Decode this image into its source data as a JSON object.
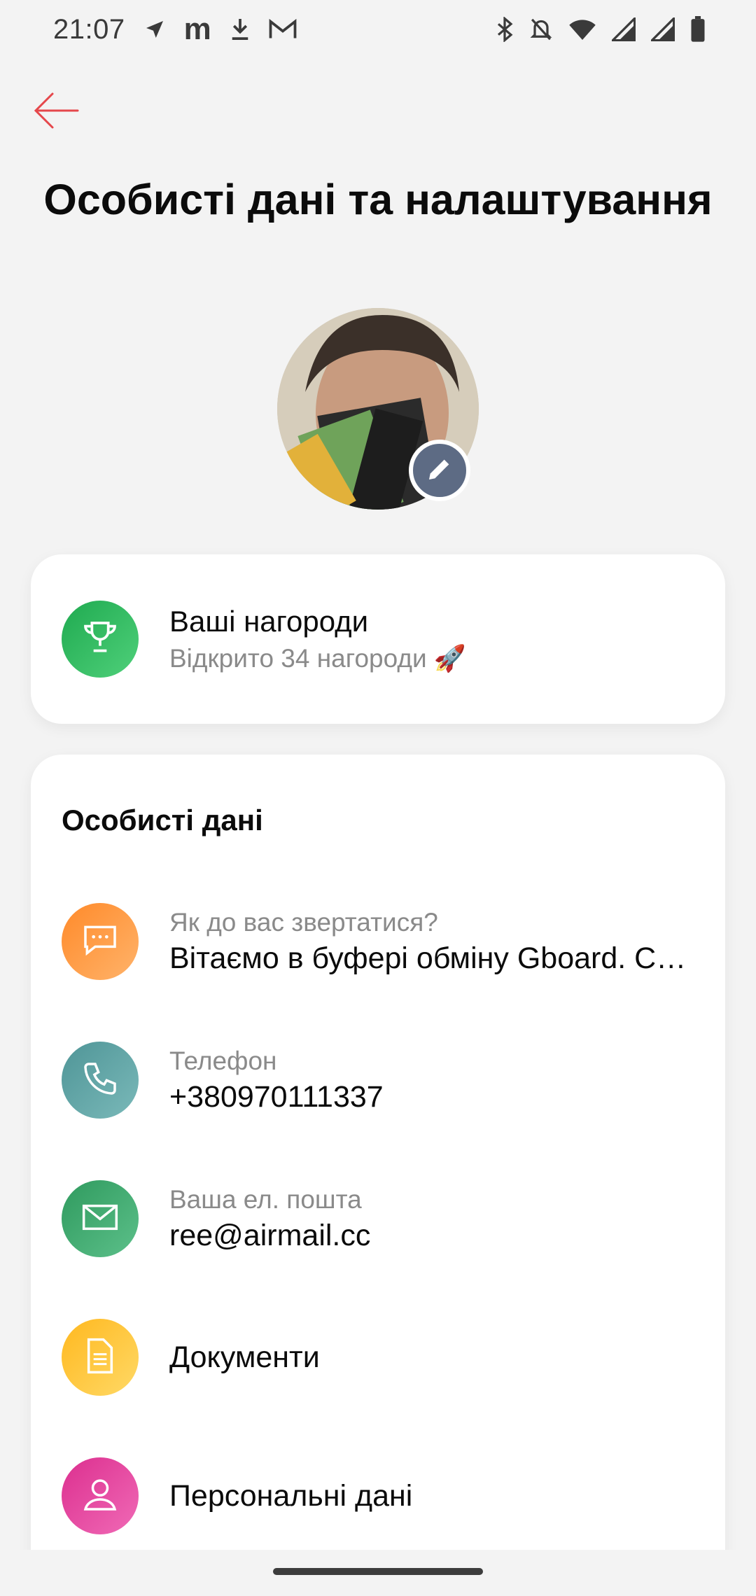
{
  "status_bar": {
    "time": "21:07",
    "left_icons": [
      "navigation-icon",
      "m-app-icon",
      "download-icon",
      "gmail-icon"
    ],
    "right_icons": [
      "bluetooth-icon",
      "notifications-off-icon",
      "wifi-icon",
      "signal-icon",
      "signal-icon-2",
      "battery-icon"
    ]
  },
  "header": {
    "title": "Особисті дані та налаштування",
    "back_icon": "arrow-left-icon",
    "accent": "#e5474b"
  },
  "profile": {
    "avatar": "user-photo",
    "edit_icon": "pencil-icon",
    "edit_badge_color": "#5d6b84"
  },
  "awards": {
    "title": "Ваші нагороди",
    "subtitle": "Відкрито 34 нагороди 🚀",
    "icon": "trophy-icon",
    "icon_color": "#2fbf5f"
  },
  "personal": {
    "section_title": "Особисті дані",
    "items": [
      {
        "label": "Як до вас звертатися?",
        "value": "Вітаємо в буфері обміну Gboard. С…",
        "icon": "chat-icon",
        "color": "#ff9a3c"
      },
      {
        "label": "Телефон",
        "value": "+380970111337",
        "icon": "phone-icon",
        "color": "#5f9ea0"
      },
      {
        "label": "Ваша ел. пошта",
        "value": "ree@airmail.cc",
        "icon": "mail-icon",
        "color": "#3fa36a"
      },
      {
        "label": "",
        "value": "Документи",
        "icon": "document-icon",
        "color": "#ffc927"
      },
      {
        "label": "",
        "value": "Персональні дані",
        "icon": "person-icon",
        "color": "#e8439a"
      }
    ]
  }
}
